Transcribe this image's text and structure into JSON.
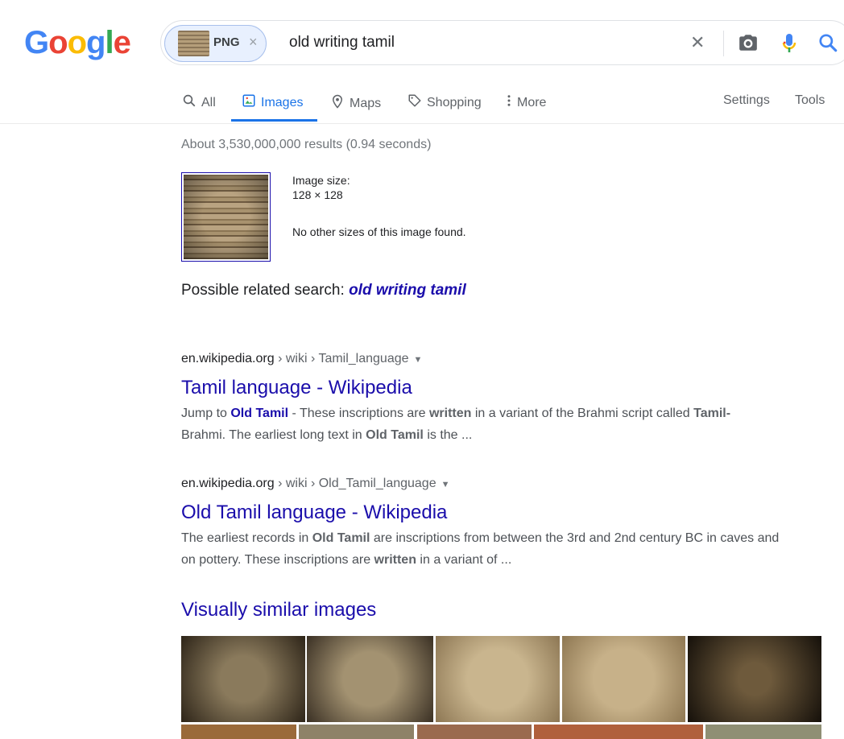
{
  "logo": {
    "letters": [
      "G",
      "o",
      "o",
      "g",
      "l",
      "e"
    ]
  },
  "search": {
    "chip_label": "PNG",
    "chip_close": "×",
    "query": "old writing tamil",
    "clear_glyph": "✕"
  },
  "tabs": [
    {
      "label": "All",
      "icon": "search-icon"
    },
    {
      "label": "Images",
      "icon": "image-icon",
      "active": true
    },
    {
      "label": "Maps",
      "icon": "map-pin-icon"
    },
    {
      "label": "Shopping",
      "icon": "tag-icon"
    },
    {
      "label": "More",
      "icon": "more-vert-icon"
    }
  ],
  "tools": {
    "settings": "Settings",
    "tools": "Tools"
  },
  "stats": "About 3,530,000,000 results (0.94 seconds)",
  "image_info": {
    "size_label": "Image size:",
    "size_value": "128 × 128",
    "note": "No other sizes of this image found."
  },
  "related": {
    "prefix": "Possible related search:",
    "term": "old writing tamil"
  },
  "results": [
    {
      "domain": "en.wikipedia.org",
      "path": " › wiki › Tamil_language",
      "title": "Tamil language - Wikipedia"
    },
    {
      "domain": "en.wikipedia.org",
      "path": " › wiki › Old_Tamil_language",
      "title": "Old Tamil language - Wikipedia"
    }
  ],
  "snippet1": {
    "s1": "Jump to ",
    "hl1": "Old Tamil",
    "s2": " - These inscriptions are ",
    "b1": "written",
    "s3": " in a variant of the Brahmi script called ",
    "b2": "Tamil-",
    "s4": "Brahmi. The earliest long text in ",
    "b3": "Old Tamil",
    "s5": " is the ..."
  },
  "snippet2": {
    "s1": "The earliest records in ",
    "b1": "Old Tamil",
    "s2": " are inscriptions from between the 3rd and 2nd century BC in caves and on pottery. These inscriptions are ",
    "b2": "written",
    "s3": " in a variant of ..."
  },
  "similar_heading": "Visually similar images",
  "colors": {
    "link": "#1a0dab",
    "accent": "#1a73e8",
    "tab_text": "#5f6368"
  }
}
